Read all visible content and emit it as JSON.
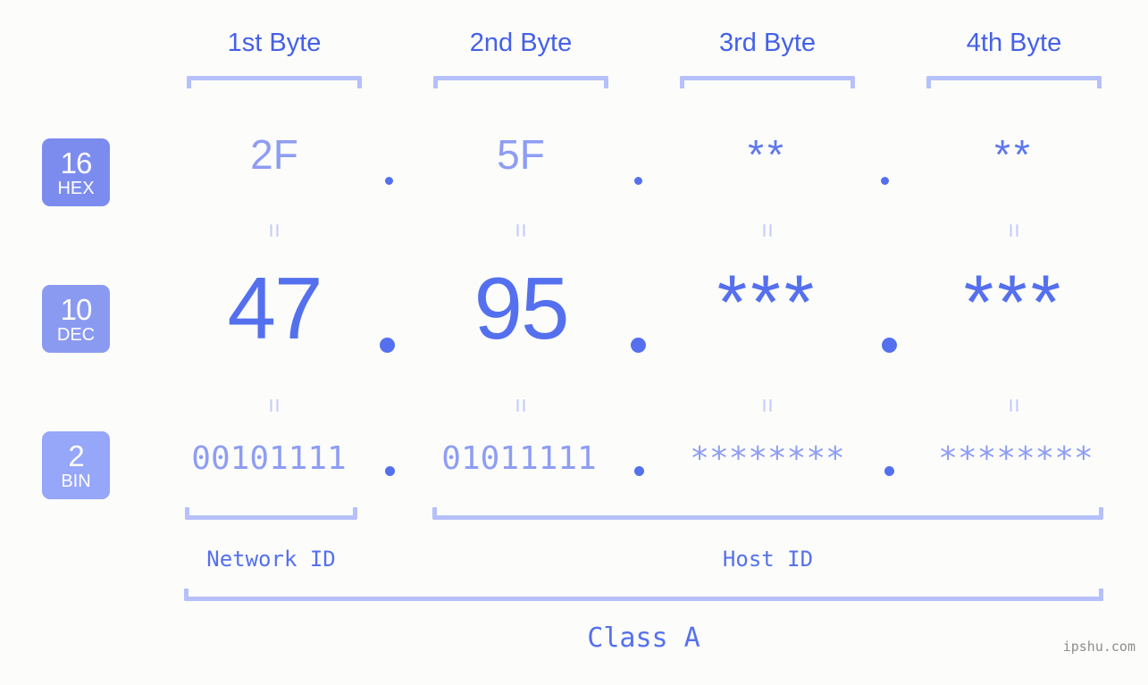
{
  "background_color": "#fcfdfa",
  "accent_color": "#5570ee",
  "muted_color": "#8e9df4",
  "bracket_color": "#b6c0fb",
  "header": {
    "bytes": [
      {
        "label": "1st Byte"
      },
      {
        "label": "2nd Byte"
      },
      {
        "label": "3rd Byte"
      },
      {
        "label": "4th Byte"
      }
    ]
  },
  "rows": [
    {
      "badge_number": "16",
      "badge_name": "HEX",
      "badge_color": "#7c8cee",
      "values": [
        "2F",
        "5F",
        "**",
        "**"
      ],
      "separator": "."
    },
    {
      "badge_number": "10",
      "badge_name": "DEC",
      "badge_color": "#8b9af1",
      "values": [
        "47",
        "95",
        "***",
        "***"
      ],
      "separator": "."
    },
    {
      "badge_number": "2",
      "badge_name": "BIN",
      "badge_color": "#96a6f8",
      "values": [
        "00101111",
        "01011111",
        "********",
        "********"
      ],
      "separator": "."
    }
  ],
  "equals_glyph": "=",
  "footer": {
    "network_id_label": "Network ID",
    "host_id_label": "Host ID",
    "class_label": "Class A",
    "watermark": "ipshu.com"
  }
}
